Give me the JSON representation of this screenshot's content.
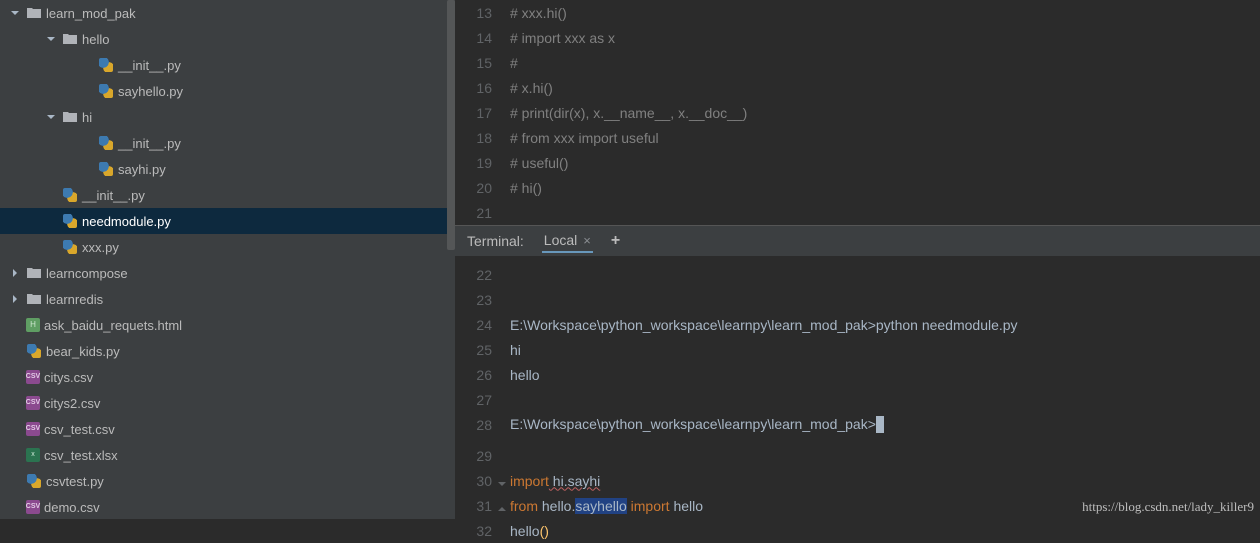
{
  "tree": [
    {
      "depth": 0,
      "arrow": "down",
      "icon": "folder",
      "label": "learn_mod_pak"
    },
    {
      "depth": 1,
      "arrow": "down",
      "icon": "folder",
      "label": "hello"
    },
    {
      "depth": 2,
      "arrow": "",
      "icon": "py",
      "label": "__init__.py"
    },
    {
      "depth": 2,
      "arrow": "",
      "icon": "py",
      "label": "sayhello.py"
    },
    {
      "depth": 1,
      "arrow": "down",
      "icon": "folder",
      "label": "hi"
    },
    {
      "depth": 2,
      "arrow": "",
      "icon": "py",
      "label": "__init__.py"
    },
    {
      "depth": 2,
      "arrow": "",
      "icon": "py",
      "label": "sayhi.py"
    },
    {
      "depth": 1,
      "arrow": "",
      "icon": "py",
      "label": "__init__.py"
    },
    {
      "depth": 1,
      "arrow": "",
      "icon": "py",
      "label": "needmodule.py",
      "selected": true
    },
    {
      "depth": 1,
      "arrow": "",
      "icon": "py",
      "label": "xxx.py"
    },
    {
      "depth": 0,
      "arrow": "right",
      "icon": "folder",
      "label": "learncompose"
    },
    {
      "depth": 0,
      "arrow": "right",
      "icon": "folder",
      "label": "learnredis"
    },
    {
      "depth": 0,
      "arrow": "",
      "icon": "html",
      "label": "ask_baidu_requets.html"
    },
    {
      "depth": 0,
      "arrow": "",
      "icon": "py",
      "label": "bear_kids.py"
    },
    {
      "depth": 0,
      "arrow": "",
      "icon": "csv",
      "label": "citys.csv"
    },
    {
      "depth": 0,
      "arrow": "",
      "icon": "csv",
      "label": "citys2.csv"
    },
    {
      "depth": 0,
      "arrow": "",
      "icon": "csv",
      "label": "csv_test.csv"
    },
    {
      "depth": 0,
      "arrow": "",
      "icon": "xlsx",
      "label": "csv_test.xlsx"
    },
    {
      "depth": 0,
      "arrow": "",
      "icon": "py",
      "label": "csvtest.py"
    },
    {
      "depth": 0,
      "arrow": "",
      "icon": "csv",
      "label": "demo.csv"
    }
  ],
  "code_top": [
    {
      "ln": 13,
      "text": "# xxx.hi()"
    },
    {
      "ln": 14,
      "text": "# import xxx as x"
    },
    {
      "ln": 15,
      "text": "#"
    },
    {
      "ln": 16,
      "text": "# x.hi()"
    },
    {
      "ln": 17,
      "text": "# print(dir(x), x.__name__, x.__doc__)"
    },
    {
      "ln": 18,
      "text": "# from xxx import useful"
    },
    {
      "ln": 19,
      "text": "# useful()"
    },
    {
      "ln": 20,
      "text": "# hi()"
    },
    {
      "ln": 21,
      "text": ""
    }
  ],
  "terminal": {
    "title": "Terminal:",
    "tab": "Local",
    "lines": [
      {
        "ln": 22,
        "text": ""
      },
      {
        "ln": 23,
        "text": ""
      },
      {
        "ln": 24,
        "text": "E:\\Workspace\\python_workspace\\learnpy\\learn_mod_pak>python needmodule.py"
      },
      {
        "ln": 25,
        "text": "hi"
      },
      {
        "ln": 26,
        "text": "hello"
      },
      {
        "ln": 27,
        "text": ""
      },
      {
        "ln": 28,
        "text": "E:\\Workspace\\python_workspace\\learnpy\\learn_mod_pak>",
        "cursor": true
      }
    ]
  },
  "code_bottom": [
    {
      "ln": 29,
      "text": ""
    },
    {
      "ln": 30,
      "kw": "import",
      "rest": " hi.sayhi",
      "wavy": true,
      "marker": "close"
    },
    {
      "ln": 31,
      "from": true,
      "kw": "from",
      "mod": "hello",
      "dot": ".",
      "sub": "sayhello",
      "kw2": "import",
      "what": "hello",
      "marker": "open"
    },
    {
      "ln": 32,
      "callid": "hello",
      "parens": "()"
    }
  ],
  "watermark": "https://blog.csdn.net/lady_killer9"
}
